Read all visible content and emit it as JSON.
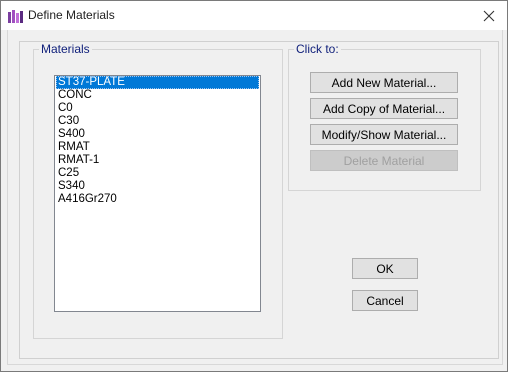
{
  "window": {
    "title": "Define Materials"
  },
  "materials_group": {
    "label": "Materials",
    "items": [
      "ST37-PLATE",
      "CONC",
      "C0",
      "C30",
      "S400",
      "RMAT",
      "RMAT-1",
      "C25",
      "S340",
      "A416Gr270"
    ],
    "selected_index": 0
  },
  "actions_group": {
    "label": "Click to:",
    "buttons": {
      "add_new": "Add New Material...",
      "add_copy": "Add Copy of Material...",
      "modify_show": "Modify/Show Material...",
      "delete": "Delete Material"
    }
  },
  "dialog_buttons": {
    "ok": "OK",
    "cancel": "Cancel"
  },
  "colors": {
    "selection": "#0078d7",
    "group_label": "#0f1f7a"
  }
}
